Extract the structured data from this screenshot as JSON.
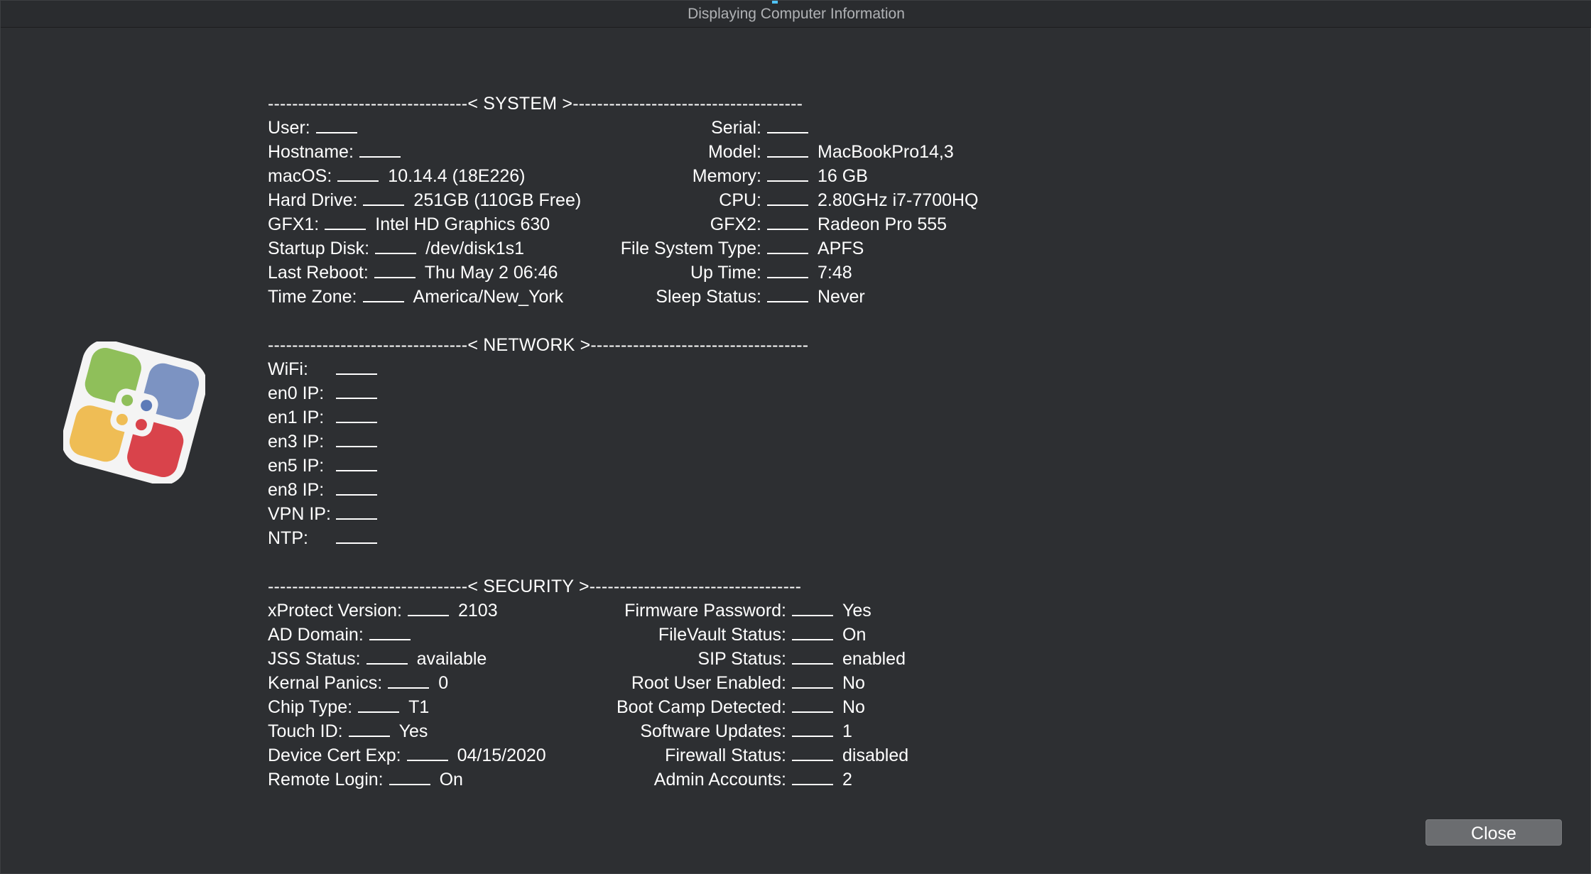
{
  "window": {
    "title": "Displaying Computer Information"
  },
  "system": {
    "divider": "---------------------------------< SYSTEM >--------------------------------------",
    "left": [
      {
        "label": "User:",
        "value": ""
      },
      {
        "label": "Hostname:",
        "value": ""
      },
      {
        "label": "macOS:",
        "value": "10.14.4 (18E226)"
      },
      {
        "label": "Hard Drive:",
        "value": "251GB (110GB Free)"
      },
      {
        "label": "GFX1:",
        "value": "Intel HD Graphics 630"
      },
      {
        "label": "Startup Disk:",
        "value": "/dev/disk1s1"
      },
      {
        "label": "Last Reboot:",
        "value": "Thu May 2 06:46"
      },
      {
        "label": "Time Zone:",
        "value": "America/New_York"
      }
    ],
    "right": [
      {
        "label": "Serial:",
        "value": ""
      },
      {
        "label": "Model:",
        "value": "MacBookPro14,3"
      },
      {
        "label": "Memory:",
        "value": "16 GB"
      },
      {
        "label": "CPU:",
        "value": "2.80GHz i7-7700HQ"
      },
      {
        "label": "GFX2:",
        "value": "Radeon Pro 555"
      },
      {
        "label": "File System Type:",
        "value": "APFS"
      },
      {
        "label": "Up Time:",
        "value": "7:48"
      },
      {
        "label": "Sleep Status:",
        "value": "Never"
      }
    ]
  },
  "network": {
    "divider": "---------------------------------< NETWORK >------------------------------------",
    "rows": [
      {
        "label": "WiFi:",
        "value": ""
      },
      {
        "label": "en0 IP:",
        "value": ""
      },
      {
        "label": "en1 IP:",
        "value": ""
      },
      {
        "label": "en3 IP:",
        "value": ""
      },
      {
        "label": "en5 IP:",
        "value": ""
      },
      {
        "label": "en8 IP:",
        "value": ""
      },
      {
        "label": "VPN IP:",
        "value": ""
      },
      {
        "label": "NTP:",
        "value": ""
      }
    ]
  },
  "security": {
    "divider": "---------------------------------< SECURITY >-----------------------------------",
    "left": [
      {
        "label": "xProtect Version:",
        "value": "2103"
      },
      {
        "label": "AD Domain:",
        "value": ""
      },
      {
        "label": "JSS Status:",
        "value": "available"
      },
      {
        "label": "Kernal Panics:",
        "value": "0"
      },
      {
        "label": "Chip Type:",
        "value": "T1"
      },
      {
        "label": "Touch ID:",
        "value": "Yes"
      },
      {
        "label": "Device Cert Exp:",
        "value": "04/15/2020"
      },
      {
        "label": "Remote Login:",
        "value": "On"
      }
    ],
    "right": [
      {
        "label": "Firmware Password:",
        "value": "Yes"
      },
      {
        "label": "FileVault Status:",
        "value": "On"
      },
      {
        "label": "SIP Status:",
        "value": "enabled"
      },
      {
        "label": "Root User Enabled:",
        "value": "No"
      },
      {
        "label": "Boot Camp Detected:",
        "value": "No"
      },
      {
        "label": "Software Updates:",
        "value": "1"
      },
      {
        "label": "Firewall Status:",
        "value": "disabled"
      },
      {
        "label": "Admin Accounts:",
        "value": "2"
      }
    ]
  },
  "buttons": {
    "close_label": "Close"
  },
  "icons": {
    "app_logo": "self-service-app-icon"
  },
  "colors": {
    "background": "#2d2f32",
    "text": "#ffffff",
    "button": "#6b6d70",
    "accent": "#4fc3f7"
  }
}
